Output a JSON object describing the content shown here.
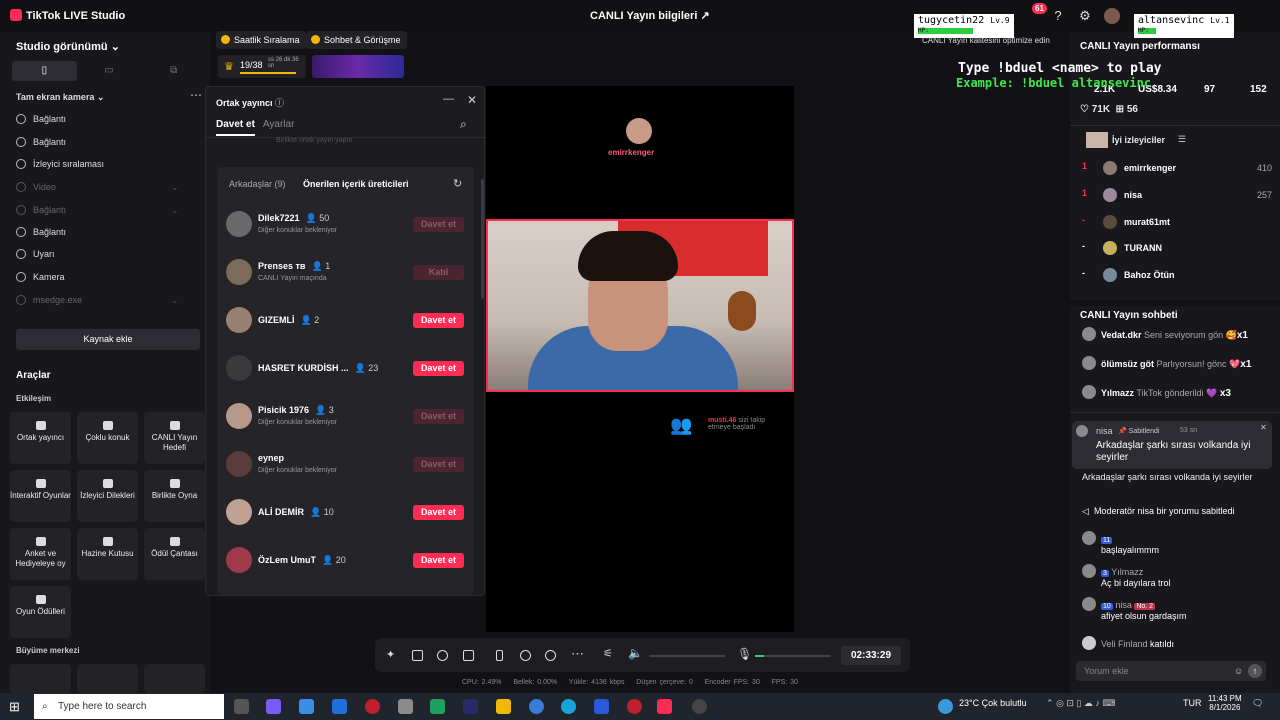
{
  "app": {
    "title": "TikTok LIVE Studio",
    "center_title": "CANLI Yayın bilgileri",
    "notif_count": "61",
    "quality_hint": "CANLI Yayın kalitesini optimize edin"
  },
  "left": {
    "studio_view": "Studio görünümü",
    "source_head": "Tam ekran kamera",
    "sources": [
      {
        "label": "Bağlantı",
        "dim": false
      },
      {
        "label": "Bağlantı",
        "dim": false
      },
      {
        "label": "İzleyici sıralaması",
        "dim": false
      },
      {
        "label": "Video",
        "dim": true
      },
      {
        "label": "Bağlantı",
        "dim": true
      },
      {
        "label": "Bağlantı",
        "dim": false
      },
      {
        "label": "Uyarı",
        "dim": false
      },
      {
        "label": "Kamera",
        "dim": false
      },
      {
        "label": "msedge.exe",
        "dim": true
      }
    ],
    "add_source": "Kaynak ekle",
    "tools_title": "Araçlar",
    "interaction": "Etkileşim",
    "tools": [
      "Ortak yayıncı",
      "Çoklu konuk",
      "CANLI Yayın Hedefi",
      "İnteraktif Oyunlar",
      "İzleyici Dilekleri",
      "Birlikte Oyna",
      "Anket ve Hediyeleye oy",
      "Hazine Kutusu",
      "Ödül Çantası",
      "Oyun Ödülleri"
    ],
    "growth": "Büyüme merkezi"
  },
  "pills": {
    "ranking": "Saatlik Sıralama",
    "chat_meet": "Sohbet & Görüşme",
    "progress": "19/38",
    "timer_small": "ss 26 dk 36 sn"
  },
  "modal": {
    "title": "Ortak yayıncı",
    "tab_invite": "Davet et",
    "tab_settings": "Ayarlar",
    "hidden_text": "Birlikte ortak yayın yapın",
    "list_tab_friends": "Arkadaşlar (9)",
    "list_tab_suggested": "Önerilen içerik üreticileri",
    "rows": [
      {
        "name": "Dilek7221",
        "count": "50",
        "status": "Diğer konuklar bekleniyor",
        "btn": "Davet et",
        "disabled": true
      },
      {
        "name": "Prenses тв",
        "count": "1",
        "status": "CANLI Yayın maçında",
        "btn": "Katıl",
        "disabled": true
      },
      {
        "name": "GIZEMLİ",
        "count": "2",
        "status": "",
        "btn": "Davet et",
        "disabled": false
      },
      {
        "name": "HASRET KURDİSH ...",
        "count": "23",
        "status": "",
        "btn": "Davet et",
        "disabled": false
      },
      {
        "name": "Pisicik 1976",
        "count": "3",
        "status": "Diğer konuklar bekleniyor",
        "btn": "Davet et",
        "disabled": true
      },
      {
        "name": "eynep",
        "count": "",
        "status": "Diğer konuklar bekleniyor",
        "btn": "Davet et",
        "disabled": true
      },
      {
        "name": "ALİ DEMİR",
        "count": "10",
        "status": "",
        "btn": "Davet et",
        "disabled": false
      },
      {
        "name": "ÖzLem UmuT",
        "count": "20",
        "status": "",
        "btn": "Davet et",
        "disabled": false
      }
    ]
  },
  "stream": {
    "top_user": "emirrkenger",
    "follow_user": "musti.46",
    "follow_text1": "sizi takip",
    "follow_text2": "etmeye başladı"
  },
  "control": {
    "timer": "02:33:29"
  },
  "statbar": {
    "cpu": "CPU: 2.49%",
    "mem": "Bellek: 0.00%",
    "upload": "Yükle: 4136 kbps",
    "dropped": "Düşen çerçeve: 0",
    "enc": "Encoder FPS: 30",
    "fps": "FPS: 30"
  },
  "right": {
    "perf": "CANLI Yayın performansı",
    "stat1": "2.1K",
    "stat2": "US$8.34",
    "stat3": "97",
    "stat4": "152",
    "likes": "71K",
    "gifts": "56",
    "top_viewers": "İyi izleyiciler",
    "ranks": [
      {
        "n": "1",
        "u": "emirrkenger",
        "v": "410"
      },
      {
        "n": "1",
        "u": "nisa",
        "v": "257"
      },
      {
        "n": "-",
        "u": "murat61mt",
        "v": ""
      },
      {
        "n": "-",
        "u": "TURANN",
        "v": ""
      },
      {
        "n": "-",
        "u": "Bahoz Ötün",
        "v": ""
      }
    ],
    "chat_title": "CANLI Yayın sohbeti",
    "chat1": {
      "u": "Vedat.dkr",
      "m": "Seni seviyorum gön",
      "x": "x1"
    },
    "chat2": {
      "u": "ölümsüz göt",
      "m": "Parlıyorsun! gönc",
      "x": "x1"
    },
    "chat3": {
      "u": "Yılmazz",
      "m": "TikTok gönderildi",
      "x": "x3"
    },
    "pinned_user": "nisa",
    "pinned_tag": "Sabitlendi",
    "pinned_time": "53 sn",
    "pinned_msg": "Arkadaşlar şarkı sırası volkanda iyi seyirler",
    "msg1": "Arkadaşlar şarkı sırası volkanda iyi seyirler",
    "mod": "Moderatör nisa bir yorumu sabitledi",
    "msg2": "başlayalımmm",
    "msg3_user": "Yılmazz",
    "msg3": "Aç bi dayılara trol",
    "msg4_user": "nisa",
    "msg4_badge": "No. 2",
    "msg4": "afiyet olsun gardaşım",
    "joined_user": "Veli Finland",
    "joined": "katıldı",
    "comment_placeholder": "Yorum ekle"
  },
  "overlay": {
    "user1": "tugycetin22",
    "lv1": "Lv.9",
    "user2": "altansevinc",
    "lv2": "Lv.1",
    "hp": "HP:",
    "cmd1": "Type !bduel <name> to play",
    "cmd2": "Example: !bduel altansevinc"
  },
  "taskbar": {
    "search": "Type here to search",
    "weather": "23°C Çok bulutlu",
    "lang": "TUR",
    "time": "11:43 PM",
    "date": "8/1/2026"
  }
}
